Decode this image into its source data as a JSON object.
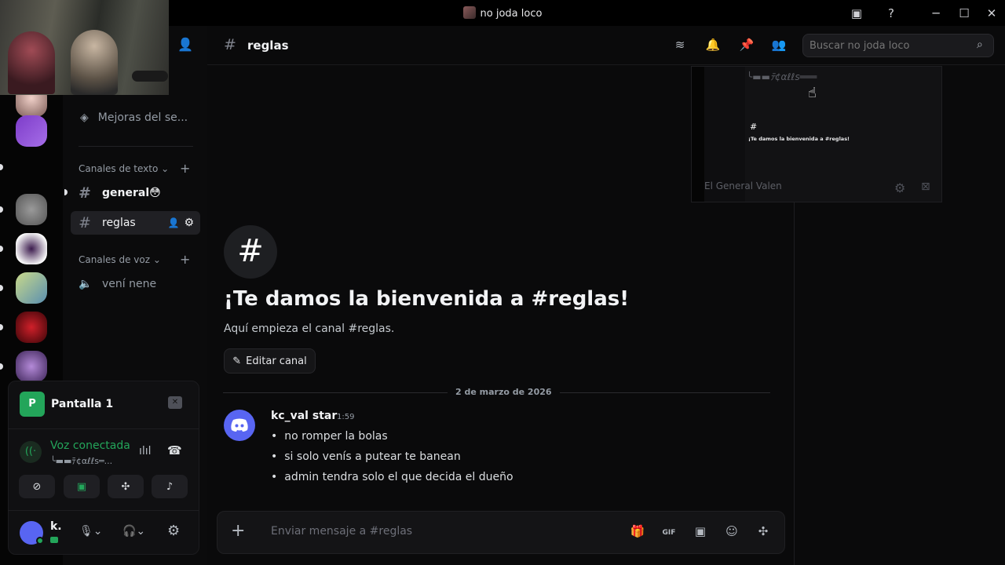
{
  "window": {
    "title": "no joda loco"
  },
  "titlebar": {
    "inbox_icon": "inbox-icon",
    "help_icon": "help-icon"
  },
  "sidebar": {
    "boost_label": "Mejoras del se...",
    "text_category": "Canales de texto",
    "voice_category": "Canales de voz",
    "channels": [
      {
        "name": "general",
        "emoji": "😳"
      },
      {
        "name": "reglas"
      }
    ],
    "voice_channels": [
      {
        "name": "vení nene"
      }
    ]
  },
  "voice": {
    "screen_label": "Pantalla 1",
    "status": "Voz conectada",
    "channel_line": "╰▬▬ﾃ¢αℓℓѕ═..."
  },
  "user": {
    "name": "k."
  },
  "header": {
    "channel": "reglas",
    "search_placeholder": "Buscar no joda loco"
  },
  "welcome": {
    "title": "¡Te damos la bienvenida a #reglas!",
    "subtitle": "Aquí empieza el canal #reglas.",
    "edit_button": "Editar canal"
  },
  "divider_date": "2 de marzo de 2026",
  "message": {
    "author": "kc_val star",
    "time": "1:59",
    "bullets": [
      "no romper la bolas",
      "si solo venís a putear te banean",
      "admin tendra solo el que decida el dueño"
    ]
  },
  "composer": {
    "placeholder": "Enviar mensaje a #reglas"
  },
  "preview": {
    "title": "¡Te damos la bienvenida a #reglas!",
    "ghost_name": "El General Valen",
    "ghost_top": "╰▬▬ﾃ¢αℓℓѕ═══"
  }
}
